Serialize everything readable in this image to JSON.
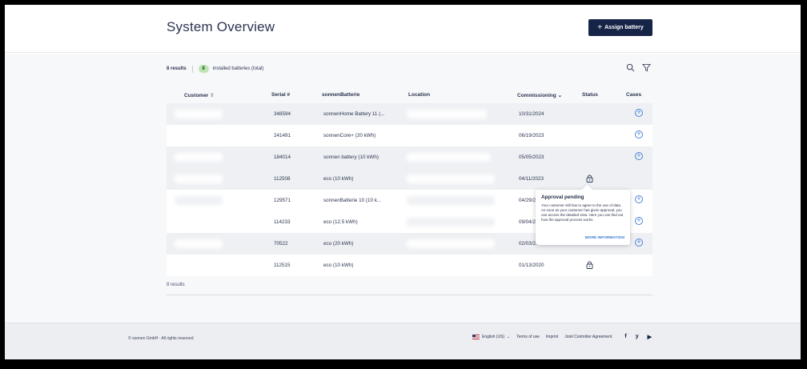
{
  "header": {
    "title": "System Overview",
    "assign_button": "Assign battery"
  },
  "summary": {
    "results": "8 results",
    "installed_count": "8",
    "installed_label": "installed batteries (total)"
  },
  "table": {
    "columns": {
      "customer": "Customer",
      "serial": "Serial #",
      "battery": "sonnenBatterie",
      "location": "Location",
      "commissioning": "Commissioning",
      "status": "Status",
      "cases": "Cases"
    },
    "rows": [
      {
        "serial": "348594",
        "battery": "sonnenHome Battery 11 (...",
        "date": "10/31/2024",
        "status": "",
        "case": "add"
      },
      {
        "serial": "241491",
        "battery": "sonnenCore+ (20 kWh)",
        "date": "06/19/2023",
        "status": "",
        "case": "add"
      },
      {
        "serial": "184014",
        "battery": "sonnen battery (10 kWh)",
        "date": "05/05/2023",
        "status": "",
        "case": "add"
      },
      {
        "serial": "112508",
        "battery": "eco (10 kWh)",
        "date": "04/11/2023",
        "status": "lock",
        "case": ""
      },
      {
        "serial": "129571",
        "battery": "sonnenBatterie 10 (10 k...",
        "date": "04/29/20",
        "status": "",
        "case": "add"
      },
      {
        "serial": "114233",
        "battery": "eco (12.5 kWh)",
        "date": "09/04/20",
        "status": "",
        "case": "add"
      },
      {
        "serial": "70522",
        "battery": "eco (20 kWh)",
        "date": "02/03/20",
        "status": "",
        "case": "add"
      },
      {
        "serial": "112515",
        "battery": "eco (10 kWh)",
        "date": "01/13/2020",
        "status": "lock",
        "case": ""
      }
    ],
    "footer_results": "8 results"
  },
  "popup": {
    "title": "Approval pending",
    "text": "Your customer still has to agree to the use of data. As soon as your customer has given approval, you can access the detailed view. Here you can find out how the approval process works.",
    "link": "MORE INFORMATION"
  },
  "footer": {
    "copyright": "© sonnen GmbH · All rights reserved",
    "language": "English (US)",
    "terms": "Terms of use",
    "imprint": "Imprint",
    "joint": "Joint Controller Agreement",
    "social": [
      "f",
      "y",
      "▶"
    ]
  },
  "colors": {
    "primary": "#162447",
    "accent": "#4c84d9",
    "badge_bg": "#bfe3b4"
  }
}
